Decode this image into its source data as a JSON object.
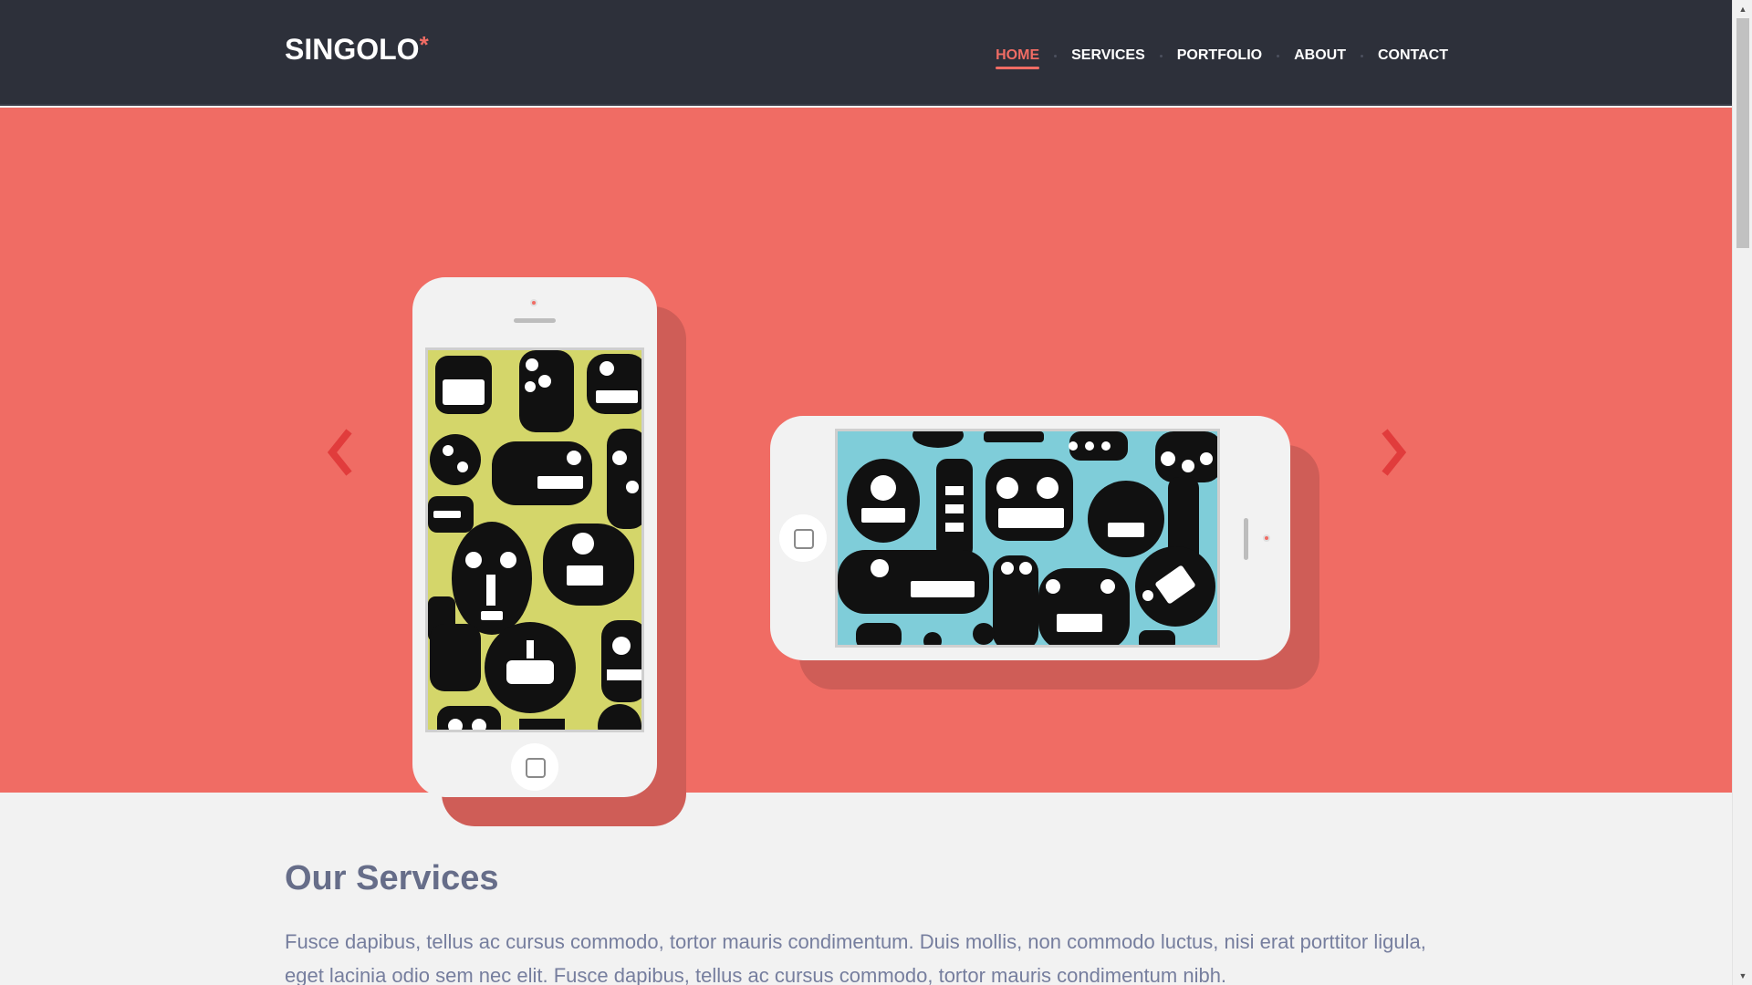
{
  "header": {
    "logo_text": "SINGOLO",
    "logo_mark": "*",
    "nav": [
      {
        "label": "HOME",
        "active": true
      },
      {
        "label": "SERVICES",
        "active": false
      },
      {
        "label": "PORTFOLIO",
        "active": false
      },
      {
        "label": "ABOUT",
        "active": false
      },
      {
        "label": "CONTACT",
        "active": false
      }
    ]
  },
  "slider": {
    "background_color": "#f06c64",
    "arrow_color": "#e13c3c",
    "prev_icon": "chevron-left-icon",
    "next_icon": "chevron-right-icon",
    "phones": [
      {
        "orientation": "vertical",
        "screen_color": "#d4d66a",
        "pattern": "monsters"
      },
      {
        "orientation": "horizontal",
        "screen_color": "#7fcdd9",
        "pattern": "monsters"
      }
    ]
  },
  "services": {
    "title": "Our Services",
    "description": "Fusce dapibus, tellus ac cursus commodo, tortor mauris condimentum. Duis mollis, non commodo luctus, nisi erat porttitor ligula, eget lacinia odio sem nec elit. Fusce dapibus, tellus ac cursus commodo, tortor mauris condimentum nibh."
  },
  "colors": {
    "header_bg": "#2d303a",
    "accent": "#f06c64",
    "title_color": "#666d89",
    "text_color": "#767e9e"
  }
}
